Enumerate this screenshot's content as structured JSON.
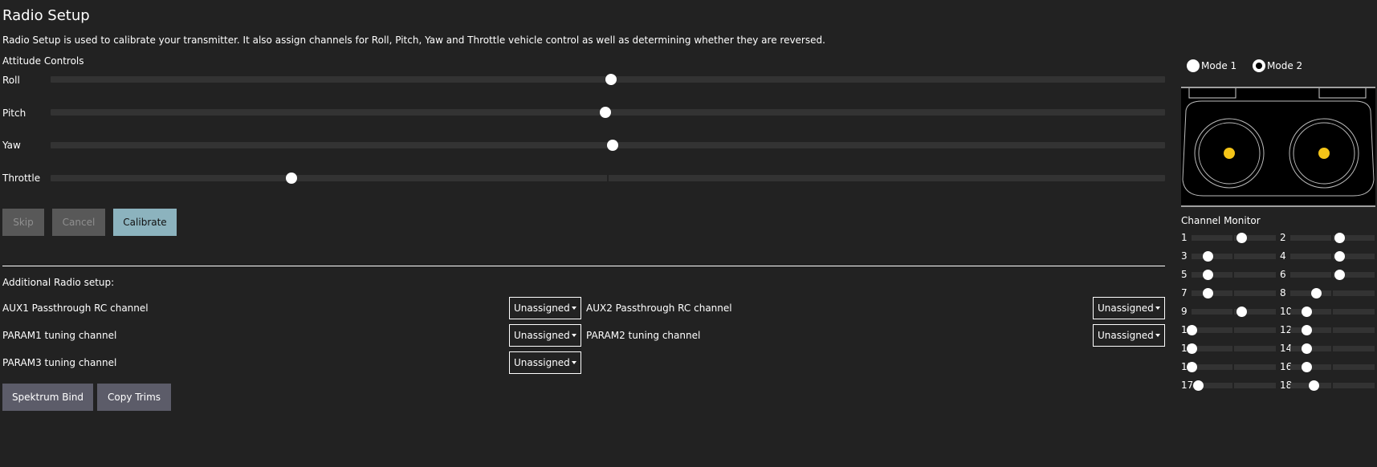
{
  "page": {
    "title": "Radio Setup",
    "description": "Radio Setup is used to calibrate your transmitter. It also assign channels for Roll, Pitch, Yaw and Throttle vehicle control as well as determining whether they are reversed."
  },
  "attitude": {
    "heading": "Attitude Controls",
    "controls": [
      {
        "label": "Roll",
        "value": 0.503
      },
      {
        "label": "Pitch",
        "value": 0.498
      },
      {
        "label": "Yaw",
        "value": 0.504
      },
      {
        "label": "Throttle",
        "value": 0.216
      }
    ]
  },
  "actions": {
    "skip": "Skip",
    "cancel": "Cancel",
    "calibrate": "Calibrate",
    "accent_color": "#8cb3be"
  },
  "additional": {
    "heading": "Additional Radio setup:",
    "options": [
      {
        "label": "AUX1 Passthrough RC channel",
        "value": "Unassigned"
      },
      {
        "label": "AUX2 Passthrough RC channel",
        "value": "Unassigned"
      },
      {
        "label": "PARAM1 tuning channel",
        "value": "Unassigned"
      },
      {
        "label": "PARAM2 tuning channel",
        "value": "Unassigned"
      },
      {
        "label": "PARAM3 tuning channel",
        "value": "Unassigned"
      }
    ],
    "spektrum_bind": "Spektrum Bind",
    "copy_trims": "Copy Trims"
  },
  "modes": {
    "mode1": "Mode 1",
    "mode2": "Mode 2",
    "selected": "Mode 2"
  },
  "transmitter": {
    "stick_color": "#f5c518"
  },
  "monitor": {
    "heading": "Channel Monitor",
    "channels": [
      {
        "label": "1",
        "value": 0.59
      },
      {
        "label": "2",
        "value": 0.58
      },
      {
        "label": "3",
        "value": 0.19
      },
      {
        "label": "4",
        "value": 0.58
      },
      {
        "label": "5",
        "value": 0.19
      },
      {
        "label": "6",
        "value": 0.58
      },
      {
        "label": "7",
        "value": 0.19
      },
      {
        "label": "8",
        "value": 0.3
      },
      {
        "label": "9",
        "value": 0.59
      },
      {
        "label": "10",
        "value": 0.19
      },
      {
        "label": "11",
        "value": 0.0
      },
      {
        "label": "12",
        "value": 0.19
      },
      {
        "label": "13",
        "value": 0.0
      },
      {
        "label": "14",
        "value": 0.19
      },
      {
        "label": "15",
        "value": 0.0
      },
      {
        "label": "16",
        "value": 0.19
      },
      {
        "label": "17",
        "value": 0.08
      },
      {
        "label": "18",
        "value": 0.28
      }
    ]
  }
}
